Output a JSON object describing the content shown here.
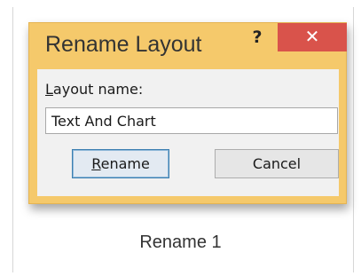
{
  "dialog": {
    "title": "Rename Layout",
    "help_glyph": "?",
    "help_icon": "question-mark-icon",
    "close_glyph": "✕",
    "close_icon": "close-icon",
    "title_bar_color": "#f5c96b",
    "close_button_color": "#d9534b",
    "field": {
      "label_accesskey": "L",
      "label_rest": "ayout name:",
      "value": "Text And Chart"
    },
    "buttons": {
      "rename_accesskey": "R",
      "rename_rest": "ename",
      "cancel_label": "Cancel"
    }
  },
  "caption": "Rename 1"
}
